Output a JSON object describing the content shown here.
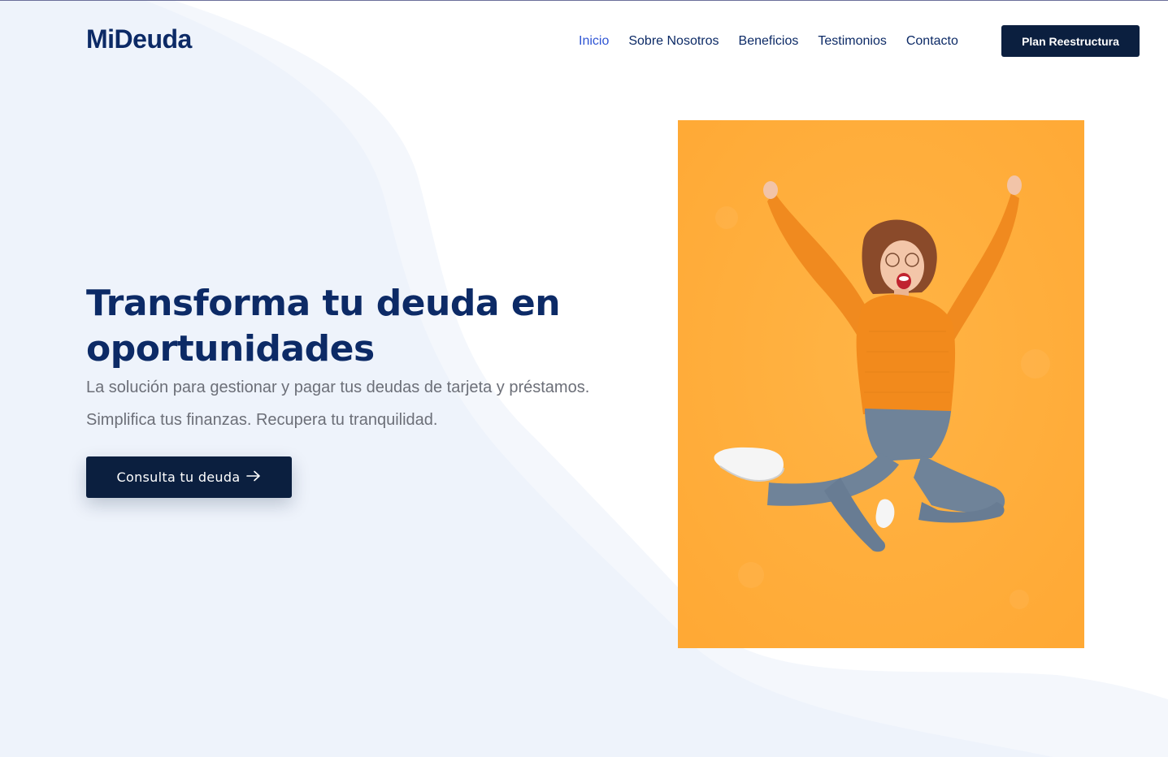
{
  "brand": {
    "name": "MiDeuda"
  },
  "nav": {
    "items": [
      {
        "label": "Inicio",
        "active": true
      },
      {
        "label": "Sobre Nosotros",
        "active": false
      },
      {
        "label": "Beneficios",
        "active": false
      },
      {
        "label": "Testimonios",
        "active": false
      },
      {
        "label": "Contacto",
        "active": false
      }
    ],
    "cta_label": "Plan Reestructura"
  },
  "hero": {
    "title": "Transforma tu deuda en oportunidades",
    "subtitle_line1": "La solución para gestionar y pagar tus deudas de tarjeta y préstamos.",
    "subtitle_line2": "Simplifica tus finanzas. Recupera tu tranquilidad.",
    "cta_label": "Consulta tu deuda",
    "cta_icon": "arrow-right-icon",
    "image_subject": "woman-jumping-photo"
  },
  "colors": {
    "brand_navy": "#0c2a66",
    "button_dark": "#0b1f3f",
    "nav_active": "#2f55d4",
    "subtitle_gray": "#6c6f78",
    "wave_light": "#eef3fb",
    "photo_background": "#ffaf3c",
    "sweater_orange": "#f28a1c",
    "jeans_blue": "#6e8298"
  }
}
